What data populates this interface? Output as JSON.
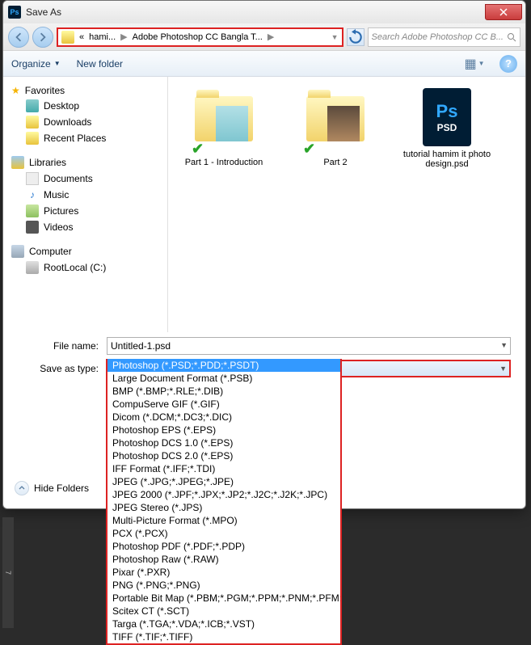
{
  "window": {
    "title": "Save As"
  },
  "nav": {
    "path_prefix": "«",
    "crumb1": "hami...",
    "crumb2": "Adobe Photoshop CC Bangla T...",
    "search_placeholder": "Search Adobe Photoshop CC B..."
  },
  "toolbar": {
    "organize": "Organize",
    "newfolder": "New folder"
  },
  "sidebar": {
    "favorites": "Favorites",
    "desktop": "Desktop",
    "downloads": "Downloads",
    "recent": "Recent Places",
    "libraries": "Libraries",
    "documents": "Documents",
    "music": "Music",
    "pictures": "Pictures",
    "videos": "Videos",
    "computer": "Computer",
    "rootlocal": "RootLocal (C:)"
  },
  "items": {
    "a": "Part 1 - Introduction",
    "b": "Part 2",
    "c": "tutorial hamim it photo design.psd",
    "psd_top": "Ps",
    "psd_bot": "PSD"
  },
  "form": {
    "name_label": "File name:",
    "name_value": "Untitled-1.psd",
    "type_label": "Save as type:",
    "type_value": "Photoshop (*.PSD;*.PDD;*.PSDT)"
  },
  "formats": [
    "Photoshop (*.PSD;*.PDD;*.PSDT)",
    "Large Document Format (*.PSB)",
    "BMP (*.BMP;*.RLE;*.DIB)",
    "CompuServe GIF (*.GIF)",
    "Dicom (*.DCM;*.DC3;*.DIC)",
    "Photoshop EPS (*.EPS)",
    "Photoshop DCS 1.0 (*.EPS)",
    "Photoshop DCS 2.0 (*.EPS)",
    "IFF Format (*.IFF;*.TDI)",
    "JPEG (*.JPG;*.JPEG;*.JPE)",
    "JPEG 2000 (*.JPF;*.JPX;*.JP2;*.J2C;*.J2K;*.JPC)",
    "JPEG Stereo (*.JPS)",
    "Multi-Picture Format (*.MPO)",
    "PCX (*.PCX)",
    "Photoshop PDF (*.PDF;*.PDP)",
    "Photoshop Raw (*.RAW)",
    "Pixar (*.PXR)",
    "PNG (*.PNG;*.PNG)",
    "Portable Bit Map (*.PBM;*.PGM;*.PPM;*.PNM;*.PFM;*.PAM)",
    "Scitex CT (*.SCT)",
    "Targa (*.TGA;*.VDA;*.ICB;*.VST)",
    "TIFF (*.TIF;*.TIFF)"
  ],
  "hide_folders": "Hide Folders",
  "ruler": "7"
}
